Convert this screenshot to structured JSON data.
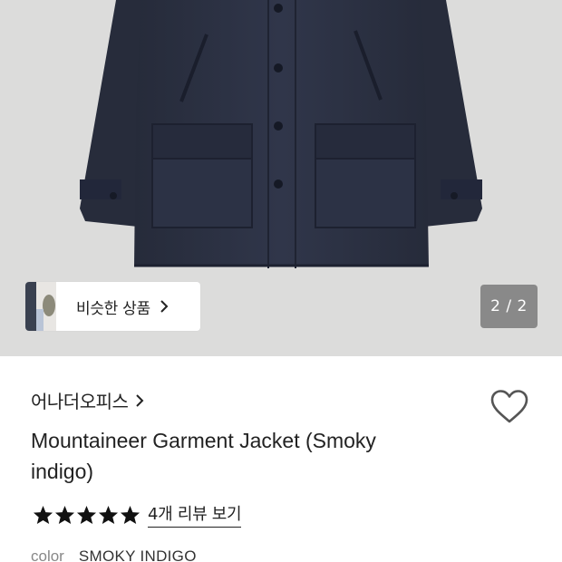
{
  "gallery": {
    "page_indicator": "2 / 2",
    "similar_products_label": "비슷한 상품"
  },
  "product": {
    "brand": "어나더오피스",
    "title": "Mountaineer Garment Jacket (Smoky indigo)",
    "rating_stars": 5,
    "review_link": "4개 리뷰 보기",
    "color_label": "color",
    "color_value": "SMOKY INDIGO"
  },
  "icons": {
    "similar_chevron": "chevron-right-icon",
    "brand_chevron": "chevron-right-icon",
    "like": "heart-outline-icon",
    "star": "star-filled-icon"
  },
  "colors": {
    "hero_background": "#dcdcdb",
    "jacket": "#2b3040",
    "text": "#222222",
    "muted_text": "#888888"
  }
}
